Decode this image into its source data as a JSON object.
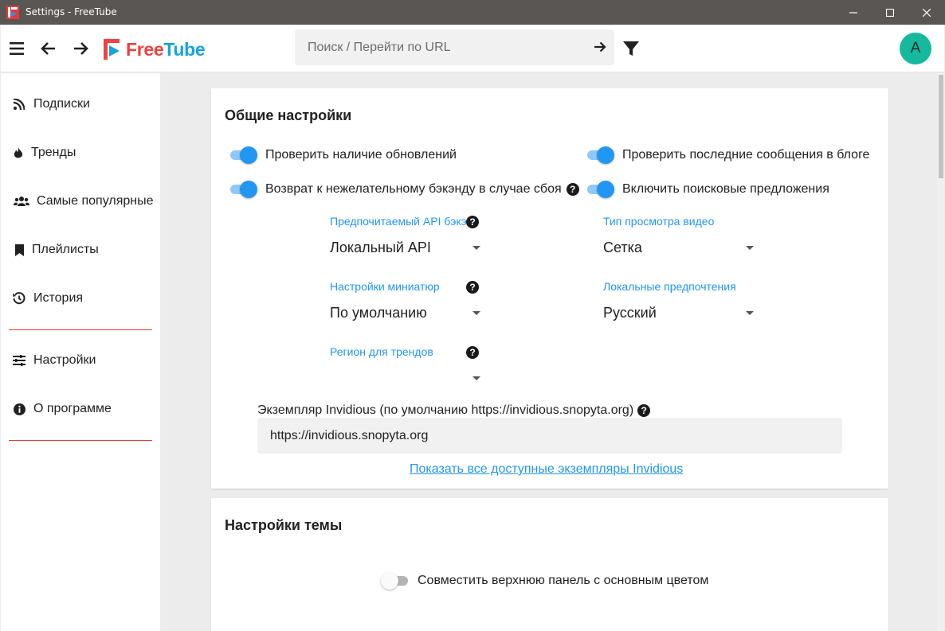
{
  "window": {
    "title": "Settings - FreeTube"
  },
  "topbar": {
    "logo_free": "Free",
    "logo_tube": "Tube",
    "search_placeholder": "Поиск / Перейти по URL",
    "avatar_letter": "A"
  },
  "sidebar": {
    "items": [
      {
        "label": "Подписки",
        "icon": "rss-icon"
      },
      {
        "label": "Тренды",
        "icon": "fire-icon"
      },
      {
        "label": "Самые популярные",
        "icon": "users-icon"
      },
      {
        "label": "Плейлисты",
        "icon": "bookmark-icon"
      },
      {
        "label": "История",
        "icon": "history-icon"
      },
      {
        "label": "Настройки",
        "icon": "sliders-icon"
      },
      {
        "label": "О программе",
        "icon": "info-icon"
      }
    ]
  },
  "general": {
    "title": "Общие настройки",
    "toggles": [
      {
        "label": "Проверить наличие обновлений",
        "on": true
      },
      {
        "label": "Проверить последние сообщения в блоге",
        "on": true
      },
      {
        "label": "Возврат к нежелательному бэкэнду в случае сбоя",
        "on": true
      },
      {
        "label": "Включить поисковые предложения",
        "on": true
      }
    ],
    "selects": [
      {
        "label": "Предпочитаемый API бэкэ",
        "value": "Локальный API"
      },
      {
        "label": "Тип просмотра видео",
        "value": "Сетка"
      },
      {
        "label": "Настройки миниатюр",
        "value": "По умолчанию"
      },
      {
        "label": "Локальные предпочтения",
        "value": "Русский"
      },
      {
        "label": "Регион для трендов",
        "value": ""
      }
    ],
    "instance_label": "Экземпляр Invidious (по умолчанию https://invidious.snopyta.org)",
    "instance_value": "https://invidious.snopyta.org",
    "instances_link": "Показать все доступные экземпляры Invidious"
  },
  "theme": {
    "title": "Настройки темы",
    "toggle_label": "Совместить верхнюю панель с основным цветом",
    "toggle_on": false
  },
  "colors": {
    "accent": "#2196f3",
    "logo_red": "#f04242",
    "logo_blue": "#14a4df",
    "avatar": "#16b99d",
    "separator": "#e53935"
  }
}
